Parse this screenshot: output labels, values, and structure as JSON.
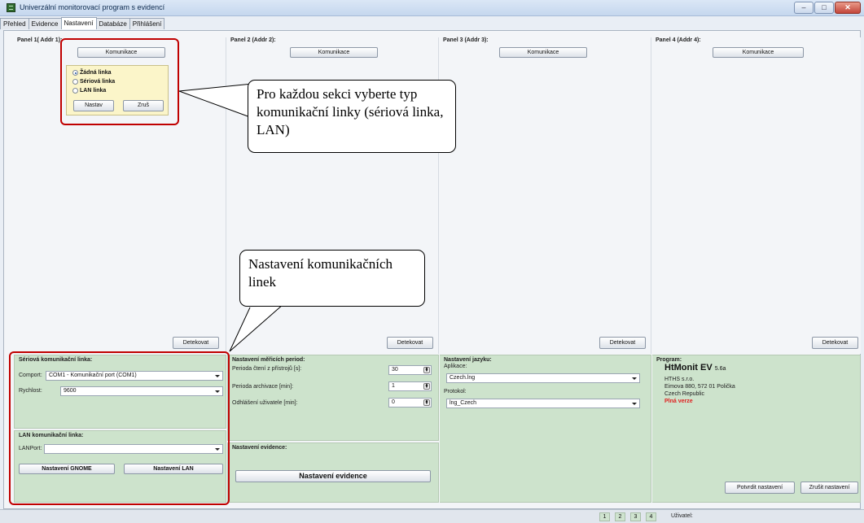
{
  "window": {
    "title": "Univerzální monitorovací program s evidencí",
    "buttons": {
      "minimize": "–",
      "maximize": "□",
      "close": "✕"
    }
  },
  "tabs": [
    "Přehled",
    "Evidence",
    "Nastavení",
    "Databáze",
    "Přihlášení"
  ],
  "active_tab": "Nastavení",
  "panels": [
    {
      "title": "Panel 1( Addr 1):",
      "komunikace": "Komunikace",
      "detect": "Detekovat"
    },
    {
      "title": "Panel 2 (Addr 2):",
      "komunikace": "Komunikace",
      "detect": "Detekovat"
    },
    {
      "title": "Panel 3 (Addr 3):",
      "komunikace": "Komunikace",
      "detect": "Detekovat"
    },
    {
      "title": "Panel 4 (Addr 4):",
      "komunikace": "Komunikace",
      "detect": "Detekovat"
    }
  ],
  "popup": {
    "options": [
      "Žádná linka",
      "Sériová linka",
      "LAN linka"
    ],
    "selected": "Žádná linka",
    "set": "Nastav",
    "cancel": "Zruš"
  },
  "callouts": {
    "link_type": "Pro každou sekci vyberte typ komunikační linky (sériová linka, LAN)",
    "link_settings": "Nastavení komunikačních linek"
  },
  "serial": {
    "title": "Sériová komunikační linka:",
    "comport_label": "Comport:",
    "comport_value": "COM1 - Komunikační port (COM1)",
    "speed_label": "Rychlost:",
    "speed_value": "9600"
  },
  "lan": {
    "title": "LAN komunikační linka:",
    "port_label": "LANPort:",
    "port_value": "",
    "gnome_button": "Nastavení GNOME",
    "lan_button": "Nastavení LAN"
  },
  "periods": {
    "title": "Nastavení měřicích period:",
    "read_label": "Perioda čtení z přístrojů [s]:",
    "read_value": "30",
    "archive_label": "Perioda archivace [min]:",
    "archive_value": "1",
    "logout_label": "Odhlášení uživatele [min]:",
    "logout_value": "0"
  },
  "evidence": {
    "title": "Nastavení evidence:",
    "button": "Nastavení evidence"
  },
  "language": {
    "title": "Nastavení jazyku:",
    "app_label": "Aplikace:",
    "app_value": "Czech.lng",
    "protocol_label": "Protokol:",
    "protocol_value": "lng_Czech"
  },
  "program": {
    "title": "Program:",
    "name": "HtMonit EV",
    "version": "5.6a",
    "company": "HTHS s.r.o.",
    "address": "Eimova 880, 572 01 Polička",
    "country": "Czech Republic",
    "license": "Plná verze"
  },
  "actions": {
    "confirm": "Potvrdit nastavení",
    "cancel": "Zrušit nastavení"
  },
  "status": {
    "pages": [
      "1",
      "2",
      "3",
      "4"
    ],
    "user_label": "Uživatel:"
  },
  "colors": {
    "highlight": "#c00000",
    "license": "#e02020",
    "green_section": "#cde3cc"
  }
}
